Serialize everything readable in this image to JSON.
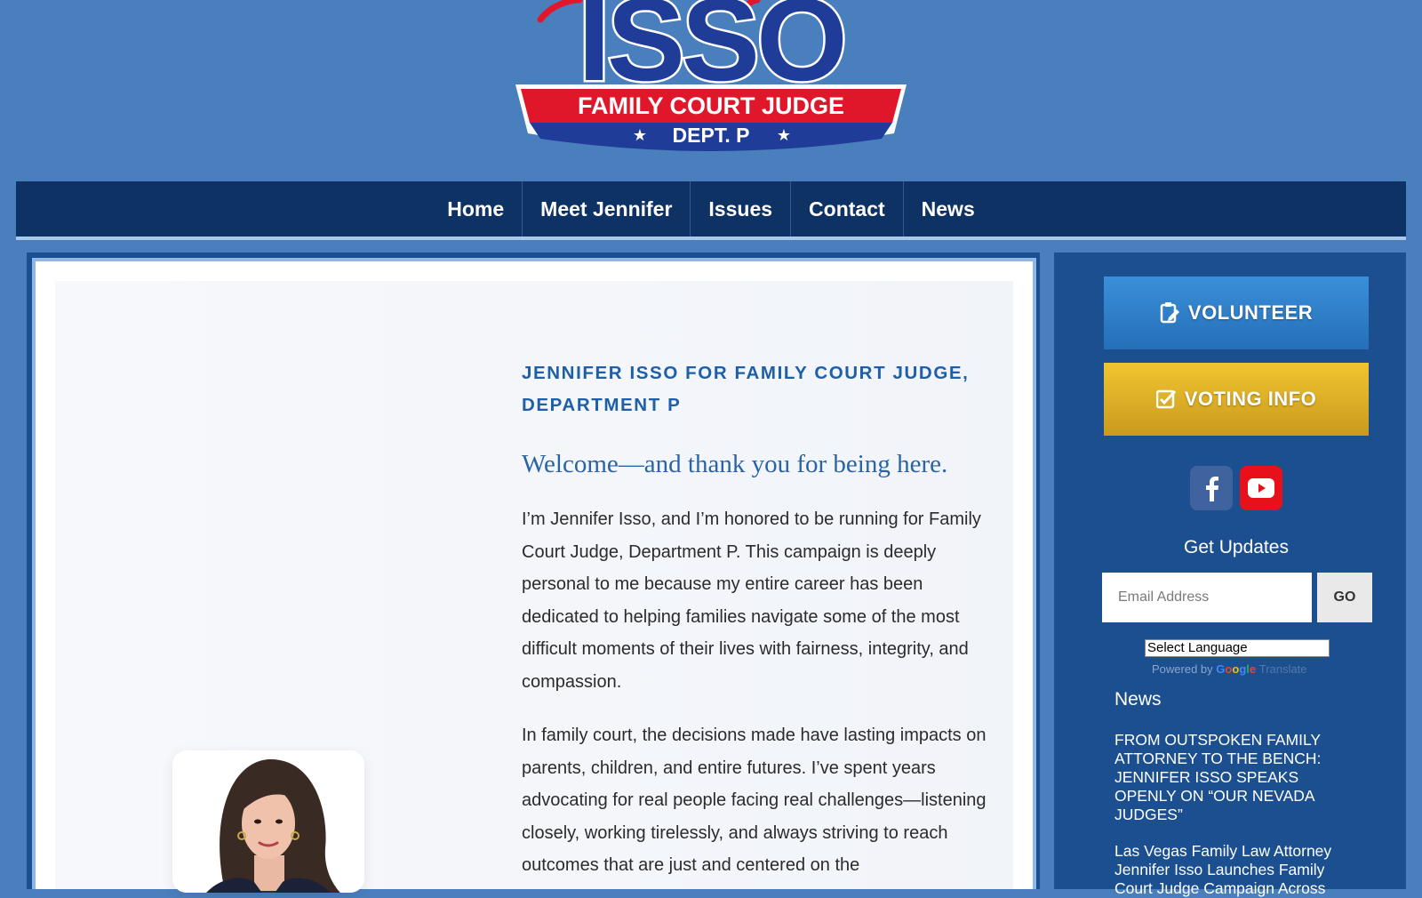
{
  "logo": {
    "name": "ISSO",
    "band_text": "FAMILY COURT JUDGE",
    "dept_text": "DEPT. P",
    "colors": {
      "blue": "#1f3d98",
      "red": "#e0172b",
      "white": "#ffffff"
    }
  },
  "nav": {
    "items": [
      {
        "label": "Home"
      },
      {
        "label": "Meet Jennifer"
      },
      {
        "label": "Issues"
      },
      {
        "label": "Contact"
      },
      {
        "label": "News"
      }
    ]
  },
  "main": {
    "headline": "JENNIFER ISSO FOR FAMILY COURT JUDGE, DEPARTMENT P",
    "welcome": "Welcome—and thank you for being here.",
    "paragraphs": [
      "I’m Jennifer Isso, and I’m honored to be running for Family Court Judge, Department P. This campaign is deeply personal to me because my entire career has been dedicated to helping families navigate some of the most difficult moments of their lives with fairness, integrity, and compassion.",
      "In family court, the decisions made have lasting impacts on parents, children, and entire futures. I’ve spent years advocating for real people facing real challenges—listening closely, working tirelessly, and always striving to reach outcomes that are just and centered on the"
    ]
  },
  "sidebar": {
    "volunteer_label": "VOLUNTEER",
    "voting_label": "VOTING INFO",
    "volunteer_icon": "clipboard-edit-icon",
    "voting_icon": "checkbox-icon",
    "social": [
      {
        "name": "facebook-icon",
        "color": "#3f639e"
      },
      {
        "name": "youtube-icon",
        "color": "#e8101b"
      }
    ],
    "updates_title": "Get Updates",
    "email_placeholder": "Email Address",
    "go_label": "GO",
    "language_select": "Select Language",
    "powered_by": "Powered by",
    "google": "Google",
    "translate": "Translate",
    "news_title": "News",
    "news": [
      {
        "title": "FROM OUTSPOKEN FAMILY ATTORNEY TO THE BENCH: JENNIFER ISSO SPEAKS OPENLY ON “OUR NEVADA JUDGES”"
      },
      {
        "title": "Las Vegas Family Law Attorney Jennifer Isso Launches Family Court Judge Campaign Across"
      }
    ]
  },
  "colors": {
    "page_bg": "#4a7fbd",
    "nav_bg": "#0e3263",
    "sidebar_bg": "#1c4f8f",
    "headline": "#1e5fa8",
    "volunteer": "#2f7fcd",
    "voting": "#dcae26"
  }
}
